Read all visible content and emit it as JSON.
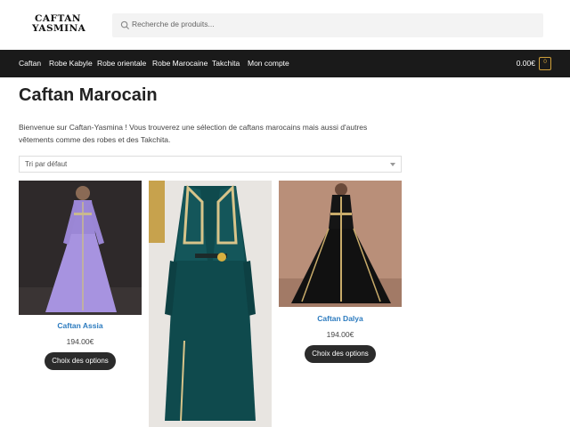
{
  "header": {
    "logo_line1": "CAFTAN",
    "logo_line2": "YASMINA",
    "search_placeholder": "Recherche de produits..."
  },
  "nav": {
    "items": [
      {
        "label": "Caftan"
      },
      {
        "label": "Robe Kabyle"
      },
      {
        "label": "Robe orientale"
      },
      {
        "label": "Robe Marocaine"
      },
      {
        "label": "Takchita"
      },
      {
        "label": "Mon compte"
      }
    ],
    "cart_total": "0.00€",
    "cart_count": "0"
  },
  "page": {
    "title": "Caftan Marocain",
    "intro_line1": "Bienvenue sur Caftan-Yasmina ! Vous trouverez une sélection de caftans marocains mais aussi d'autres",
    "intro_line2": "vêtements comme des robes et des Takchita.",
    "sort_label": "Tri par défaut"
  },
  "products": [
    {
      "title": "Caftan Assia",
      "price": "194.00€",
      "button": "Choix des options"
    },
    {
      "title": "",
      "price": "",
      "button": ""
    },
    {
      "title": "Caftan Dalya",
      "price": "194.00€",
      "button": "Choix des options"
    }
  ],
  "colors": {
    "nav_bg": "#1a1a1a",
    "accent_link": "#2c7bbf",
    "cart_accent": "#d1a03a",
    "button_bg": "#2b2b2b"
  }
}
